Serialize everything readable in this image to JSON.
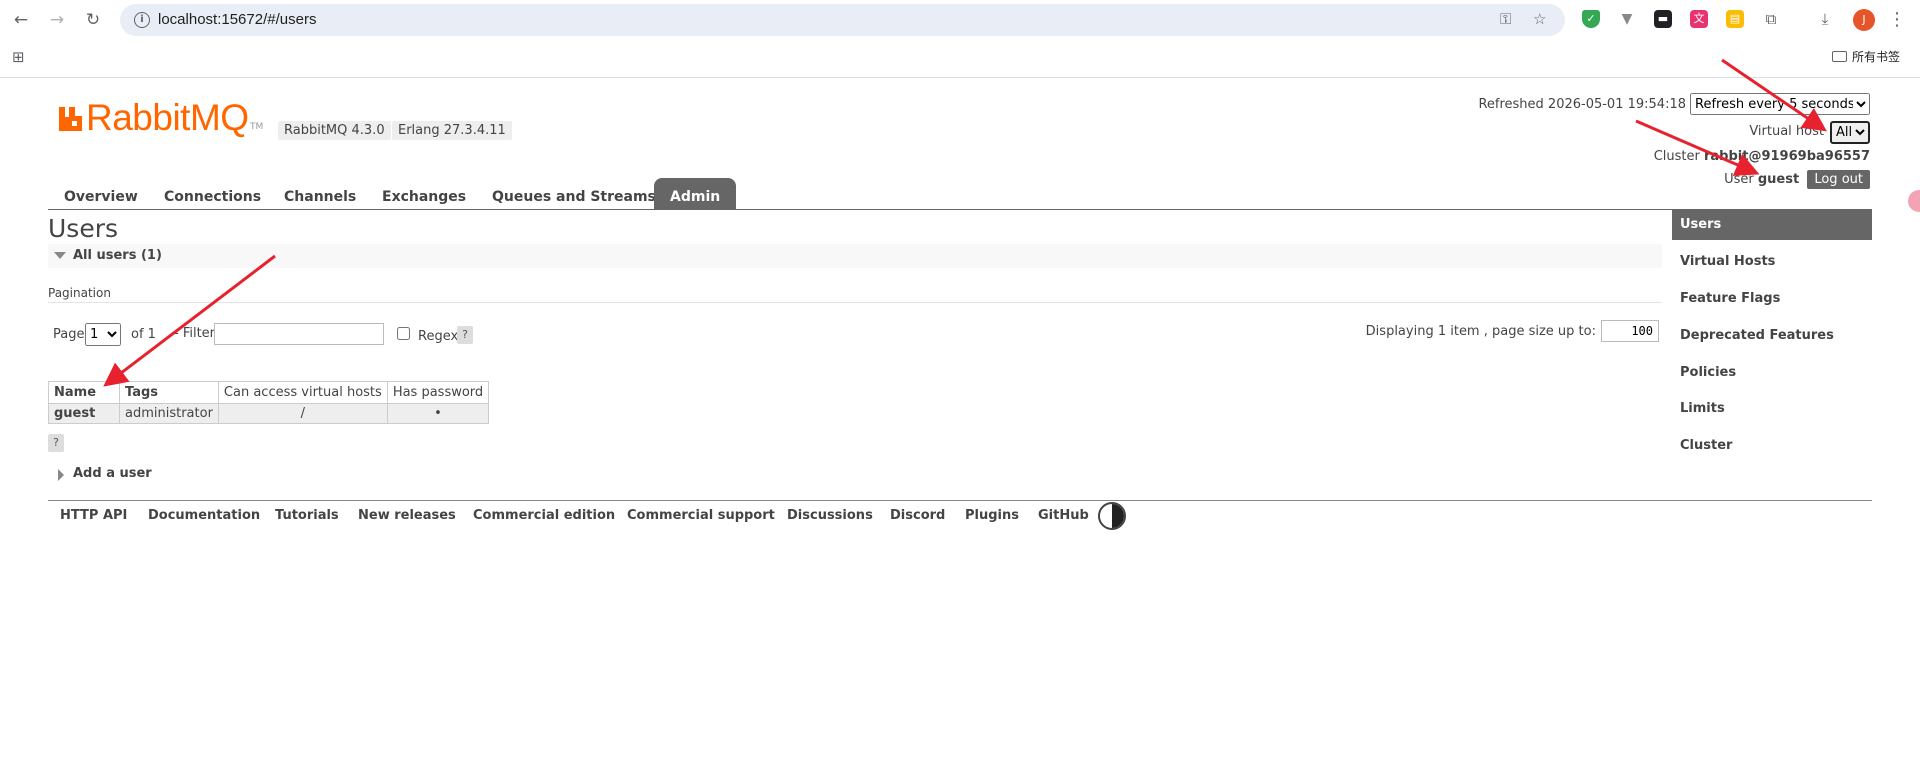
{
  "browser": {
    "url": "localhost:15672/#/users",
    "bookmarks_label": "所有书签",
    "avatar_initial": "J",
    "extensions": [
      "shield-ext",
      "vivaldi-ext",
      "game-ext",
      "translate-ext",
      "notes-ext"
    ]
  },
  "header": {
    "logo_text": "RabbitMQ",
    "logo_tm": "TM",
    "rabbitmq_version": "RabbitMQ 4.3.0",
    "erlang_version": "Erlang 27.3.4.11",
    "refreshed_text": "Refreshed 2026-05-01 19:54:18",
    "refresh_selected": "Refresh every 5 seconds",
    "vhost_label": "Virtual host",
    "vhost_selected": "All",
    "cluster_label": "Cluster",
    "cluster_name": "rabbit@91969ba96557",
    "user_label": "User",
    "user_name": "guest",
    "logout_label": "Log out"
  },
  "tabs": [
    {
      "label": "Overview",
      "active": false
    },
    {
      "label": "Connections",
      "active": false
    },
    {
      "label": "Channels",
      "active": false
    },
    {
      "label": "Exchanges",
      "active": false
    },
    {
      "label": "Queues and Streams",
      "active": false
    },
    {
      "label": "Admin",
      "active": true
    }
  ],
  "main": {
    "title": "Users",
    "section_label": "All users (1)",
    "pagination_label": "Pagination",
    "page_label": "Page",
    "page_selected": "1",
    "of_label": "of 1",
    "filter_label": "- Filter:",
    "filter_value": "",
    "regex_label": "Regex",
    "help_label": "?",
    "displaying_text": "Displaying 1 item , page size up to:",
    "page_size": "100",
    "table": {
      "headers": [
        "Name",
        "Tags",
        "Can access virtual hosts",
        "Has password"
      ],
      "rows": [
        [
          "guest",
          "administrator",
          "/",
          "•"
        ]
      ]
    },
    "add_user_label": "Add a user"
  },
  "sidebar": {
    "items": [
      {
        "label": "Users",
        "active": true
      },
      {
        "label": "Virtual Hosts",
        "active": false
      },
      {
        "label": "Feature Flags",
        "active": false
      },
      {
        "label": "Deprecated Features",
        "active": false
      },
      {
        "label": "Policies",
        "active": false
      },
      {
        "label": "Limits",
        "active": false
      },
      {
        "label": "Cluster",
        "active": false
      }
    ]
  },
  "footer": {
    "links": [
      "HTTP API",
      "Documentation",
      "Tutorials",
      "New releases",
      "Commercial edition",
      "Commercial support",
      "Discussions",
      "Discord",
      "Plugins",
      "GitHub"
    ]
  },
  "colors": {
    "brand_orange": "#ff6600",
    "tab_active": "#666666",
    "annotation_arrow": "#e8212e"
  }
}
